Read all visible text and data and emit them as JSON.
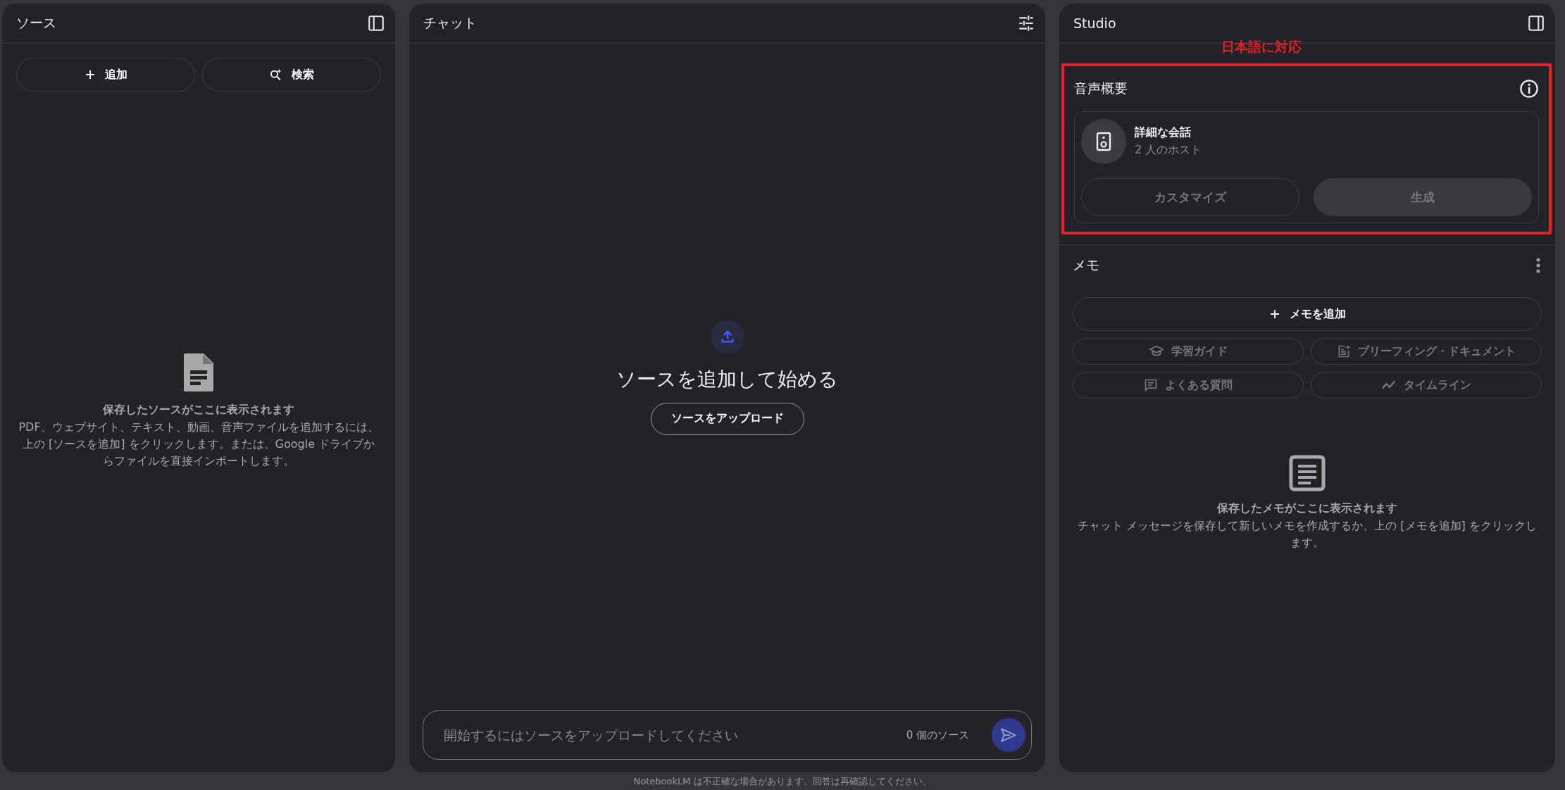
{
  "sources": {
    "title": "ソース",
    "buttons": [
      {
        "kind": "add",
        "label": "追加"
      },
      {
        "kind": "search",
        "label": "検索"
      }
    ],
    "empty": {
      "title": "保存したソースがここに表示されます",
      "text": "PDF、ウェブサイト、テキスト、動画、音声ファイルを追加するには、上の [ソースを追加] をクリックします。または、Google ドライブからファイルを直接インポートします。"
    }
  },
  "chat": {
    "title": "チャット",
    "heading": "ソースを追加して始める",
    "upload_button": "ソースをアップロード",
    "input": {
      "placeholder": "開始するにはソースをアップロードしてください",
      "count": "0 個のソース",
      "send_disabled": true
    }
  },
  "studio": {
    "title": "Studio",
    "annotation": "日本語に対応",
    "audio": {
      "title": "音声概要",
      "card_title": "詳細な会話",
      "card_subtitle": "2 人のホスト",
      "buttons": [
        {
          "kind": "outline",
          "label": "カスタマイズ",
          "disabled": true
        },
        {
          "kind": "filled",
          "label": "生成",
          "disabled": true
        }
      ]
    },
    "memo": {
      "title": "メモ",
      "add_button": "メモを追加",
      "buttons": [
        {
          "kind": "study",
          "label": "学習ガイド",
          "disabled": true
        },
        {
          "kind": "briefing",
          "label": "ブリーフィング・ドキュメント",
          "disabled": true
        },
        {
          "kind": "faq",
          "label": "よくある質問",
          "disabled": true
        },
        {
          "kind": "timeline",
          "label": "タイムライン",
          "disabled": true
        }
      ],
      "empty": {
        "title": "保存したメモがここに表示されます",
        "text": "チャット メッセージを保存して新しいメモを作成するか、上の [メモを追加] をクリックします。"
      }
    }
  },
  "footer": "NotebookLM は不正確な場合があります。回答は再確認してください。"
}
